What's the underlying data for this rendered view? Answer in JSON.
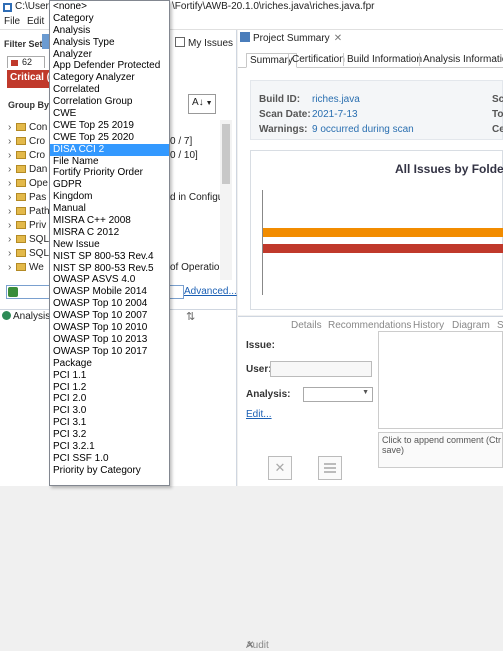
{
  "titlebar": {
    "path_left": "C:\\Users",
    "path_right": "\\Fortify\\AWB-20.1.0\\riches.java\\riches.java.fpr"
  },
  "menu": [
    "File",
    "Edit"
  ],
  "filter": {
    "filter_set_label": "Filter Set:",
    "my_issues_label": "My Issues",
    "tab_count": "62",
    "critical_label": "Critical (",
    "group_by_label": "Group By:",
    "sort_label": "A↓"
  },
  "tree": [
    {
      "text": "Con"
    },
    {
      "text": "Cro"
    },
    {
      "text": "Cro"
    },
    {
      "text": "Dan"
    },
    {
      "text": "Ope"
    },
    {
      "text": "Pas"
    },
    {
      "text": "Path"
    },
    {
      "text": "Priv"
    },
    {
      "text": "SQL"
    },
    {
      "text": "SQL"
    },
    {
      "text": "We"
    }
  ],
  "tree_right_fragments": [
    "0 / 7]",
    "0 / 10]",
    "d in Configu",
    "of Operatio"
  ],
  "search": {
    "advanced_label": "Advanced..."
  },
  "analysis_tab": "Analysis",
  "project_summary": {
    "title": "Project Summary",
    "tabs": [
      "Summary",
      "Certification",
      "Build Information",
      "Analysis Information"
    ],
    "build_id_label": "Build ID:",
    "build_id": "riches.java",
    "scan_date_label": "Scan Date:",
    "scan_date": "2021-7-13",
    "warnings_label": "Warnings:",
    "warnings": "9 occurred during scan",
    "right_col_letters": [
      "Sc",
      "To",
      "Ce"
    ],
    "chart_title": "All Issues by Folder"
  },
  "chart_data": {
    "type": "bar",
    "title": "All Issues by Folder",
    "series": [
      {
        "color": "#f28c00",
        "values": [
          1.0
        ]
      },
      {
        "color": "#c0392b",
        "values": [
          1.0
        ]
      }
    ]
  },
  "audit": {
    "tabs": [
      "Audit",
      "Details",
      "Recommendations",
      "History",
      "Diagram",
      "S"
    ],
    "issue_label": "Issue:",
    "user_label": "User:",
    "analysis_label": "Analysis:",
    "edit_label": "Edit...",
    "comment_placeholder_line1": "Click to append comment (Ctr",
    "comment_placeholder_line2": "save)"
  },
  "dropdown": {
    "selected": "DISA CCI 2",
    "items": [
      "<none>",
      "Category",
      "Analysis",
      "Analysis Type",
      "Analyzer",
      "App Defender Protected",
      "Category Analyzer",
      "Correlated",
      "Correlation Group",
      "CWE",
      "CWE Top 25 2019",
      "CWE Top 25 2020",
      "DISA CCI 2",
      "File Name",
      "Fortify Priority Order",
      "GDPR",
      "Kingdom",
      "Manual",
      "MISRA C++ 2008",
      "MISRA C 2012",
      "New Issue",
      "NIST SP 800-53 Rev.4",
      "NIST SP 800-53 Rev.5",
      "OWASP ASVS 4.0",
      "OWASP Mobile 2014",
      "OWASP Top 10 2004",
      "OWASP Top 10 2007",
      "OWASP Top 10 2010",
      "OWASP Top 10 2013",
      "OWASP Top 10 2017",
      "Package",
      "PCI 1.1",
      "PCI 1.2",
      "PCI 2.0",
      "PCI 3.0",
      "PCI 3.1",
      "PCI 3.2",
      "PCI 3.2.1",
      "PCI SSF 1.0",
      "Priority by Category"
    ]
  }
}
